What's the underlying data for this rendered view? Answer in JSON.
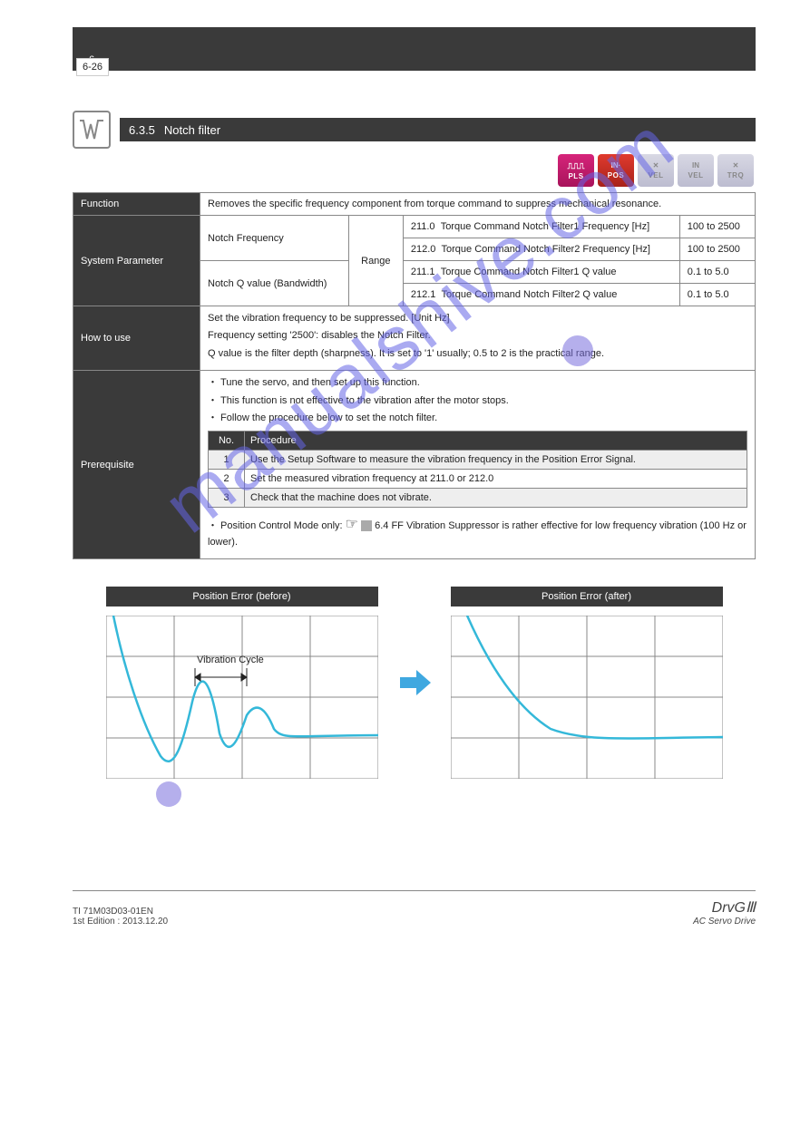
{
  "header": {
    "section_no": "6",
    "page_no": "6-26"
  },
  "section": {
    "number": "6.3.5",
    "title": "Notch filter"
  },
  "modes": {
    "pls": {
      "top": "⎍⎍⎍",
      "bot": "PLS"
    },
    "pos": {
      "top": "IN·",
      "bot": "POS"
    },
    "vel": {
      "top": "✕",
      "bot": "VEL"
    },
    "inv": {
      "top": "IN",
      "bot": "VEL"
    },
    "trq": {
      "top": "✕",
      "bot": "TRQ"
    }
  },
  "table": {
    "rows": {
      "function_lbl": "Function",
      "function_val": "Removes the specific frequency component from torque command to suppress mechanical resonance.",
      "param_lbl": "System Parameter",
      "how_lbl": "How to use",
      "prereq_lbl": "Prerequisite"
    },
    "params": {
      "c1_label": "Notch Frequency",
      "c1_label2": "Notch Q value (Bandwidth)",
      "rng_lbl": "Range",
      "p1_id": "211.0",
      "p1_name": "Torque Command Notch Filter1 Frequency [Hz]",
      "p1_rng": "100 to 2500",
      "p2_id": "212.0",
      "p2_name": "Torque Command Notch Filter2 Frequency [Hz]",
      "p2_rng": "100 to 2500",
      "p3_id": "211.1",
      "p3_name": "Torque Command Notch Filter1 Q value",
      "p3_rng": "0.1 to 5.0",
      "p4_id": "212.1",
      "p4_name": "Torque Command Notch Filter2 Q value",
      "p4_rng": "0.1 to 5.0"
    },
    "how": {
      "line1": "Set the vibration frequency to be suppressed. [Unit Hz]",
      "line2": "Frequency setting '2500': disables the Notch Filter.",
      "line3": "Q value is the filter depth (sharpness). It is set to '1' usually; 0.5 to 2 is the practical range."
    },
    "prereq": {
      "line1": "・ Tune the servo, and then set up this function.",
      "line2": "・ This function is not effective to the vibration after the motor stops.",
      "line3": "・ Follow the procedure below to set the notch filter.",
      "tbl": {
        "h1": "No.",
        "h2": "Procedure",
        "r1n": "1",
        "r1t": "Use the Setup Software to measure the vibration frequency in the Position Error Signal.",
        "r2n": "2",
        "r2t": "Set the measured vibration frequency at 211.0 or 212.0",
        "r3n": "3",
        "r3t": "Check that the machine does not vibrate."
      },
      "line4_a": "・ Position Control Mode only: ",
      "line4_b": " 6.4 FF Vibration Suppressor is rather effective for low frequency vibration (100 Hz or lower)."
    }
  },
  "charts": {
    "left_title": "Position Error (before)",
    "right_title": "Position Error (after)"
  },
  "chart_data": [
    {
      "type": "line",
      "title": "Position Error (before)",
      "annotation": "Vibration Cycle",
      "xlabel": "",
      "ylabel": "",
      "xlim": [
        0,
        4
      ],
      "ylim": [
        -1,
        3
      ],
      "series": [
        {
          "name": "error",
          "values_desc": "exponential decay with damped oscillation overshoot settling to zero"
        }
      ]
    },
    {
      "type": "line",
      "title": "Position Error (after)",
      "xlabel": "",
      "ylabel": "",
      "xlim": [
        0,
        4
      ],
      "ylim": [
        -1,
        3
      ],
      "series": [
        {
          "name": "error",
          "values_desc": "smooth exponential decay to zero without oscillation"
        }
      ]
    }
  ],
  "footer": {
    "left1": "TI 71M03D03-01EN",
    "left2": "1st Edition : 2013.12.20",
    "right1": "DrvGⅢ",
    "right2": "AC Servo Drive"
  },
  "watermark": "manualshive.com"
}
